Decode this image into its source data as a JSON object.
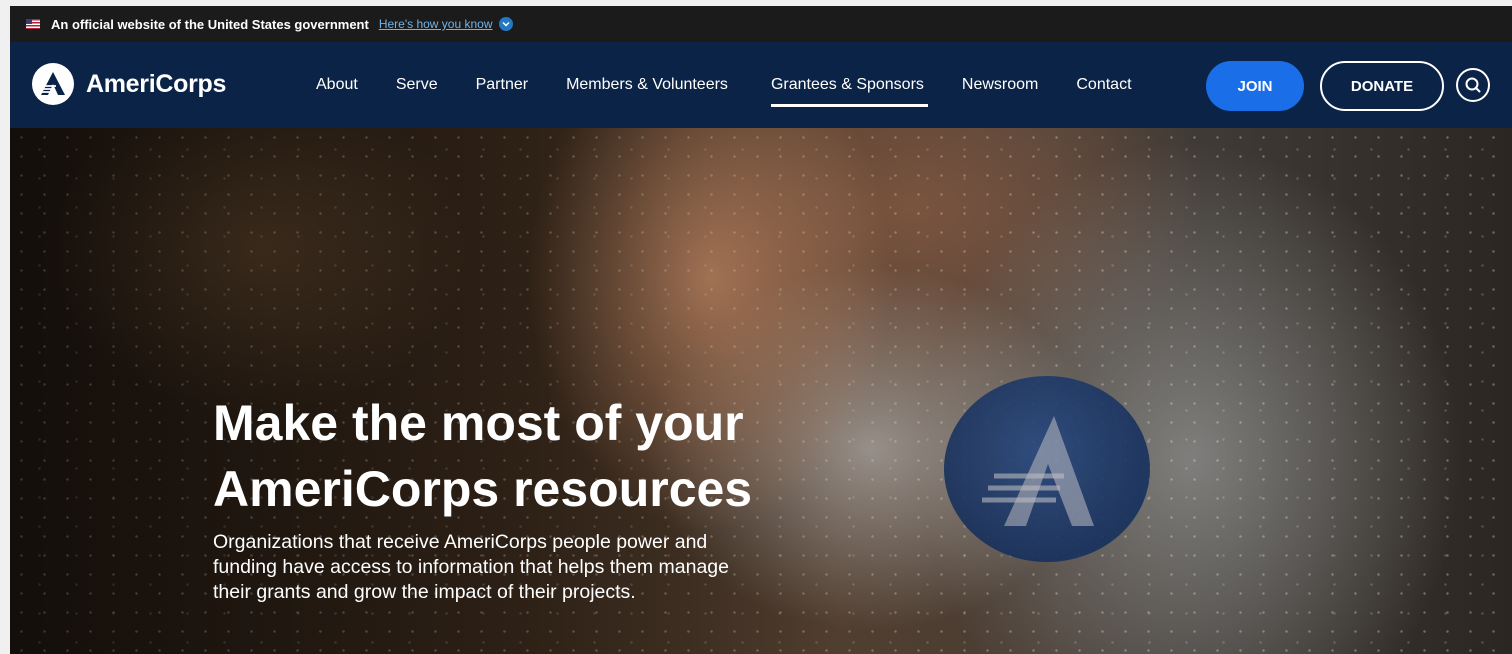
{
  "gov_banner": {
    "text": "An official website of the United States government",
    "link": "Here's how you know"
  },
  "header": {
    "logo_text": "AmeriCorps",
    "nav": [
      {
        "label": "About"
      },
      {
        "label": "Serve"
      },
      {
        "label": "Partner"
      },
      {
        "label": "Members & Volunteers"
      },
      {
        "label": "Grantees & Sponsors",
        "active": true
      },
      {
        "label": "Newsroom"
      },
      {
        "label": "Contact"
      }
    ],
    "join_label": "JOIN",
    "donate_label": "DONATE"
  },
  "hero": {
    "title_line1": "Make the most of your",
    "title_line2": "AmeriCorps resources",
    "subtitle_line1": "Organizations that receive AmeriCorps people power and",
    "subtitle_line2": "funding have access to information that helps them manage",
    "subtitle_line3": "their grants and grow the impact of their projects."
  },
  "colors": {
    "gov_banner_bg": "#1b1b1b",
    "header_bg": "#0b2346",
    "join_button": "#1a6fe8",
    "gov_link": "#73b3e7"
  },
  "icons": [
    "us-flag-icon",
    "chevron-down-icon",
    "americorps-logo-icon",
    "search-icon"
  ]
}
